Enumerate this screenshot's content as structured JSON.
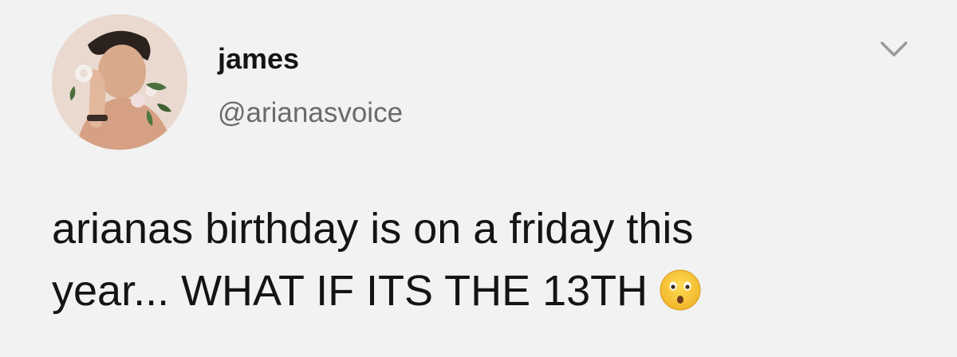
{
  "tweet": {
    "user": {
      "display_name": "james",
      "handle": "@arianasvoice",
      "avatar_icon": "profile-photo"
    },
    "menu_icon": "chevron-down-icon",
    "text_line_1": "arianas birthday is on a friday this",
    "text_line_2": "year... WHAT IF ITS THE 13TH",
    "emoji_icon": "hushed-face-emoji",
    "colors": {
      "background": "#f2f2f2",
      "name": "#141414",
      "handle": "#6a6a6a",
      "caret": "#9a9a9a",
      "emoji": "#f4c33b"
    }
  }
}
